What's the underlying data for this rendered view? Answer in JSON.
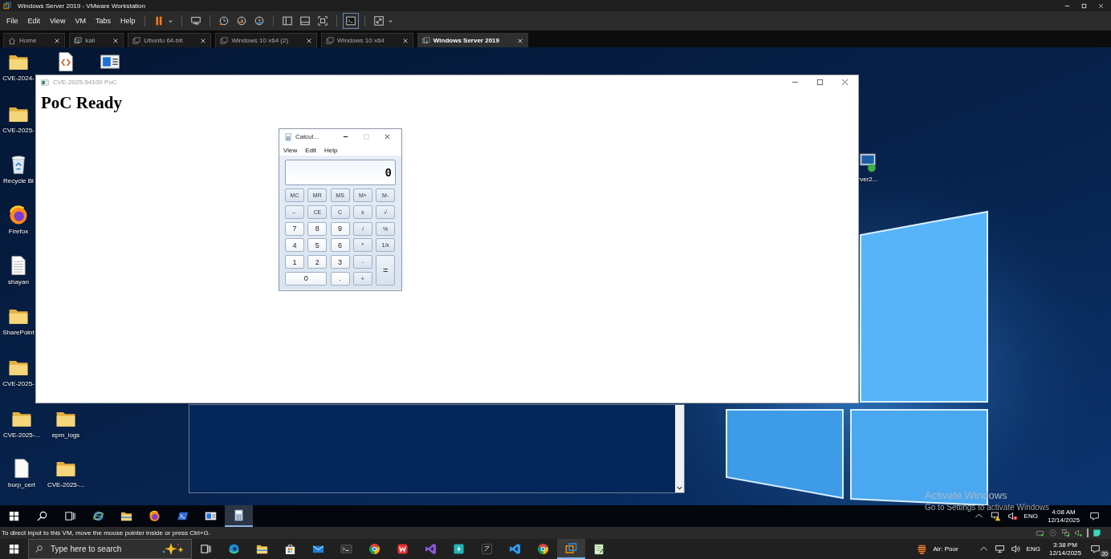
{
  "vmware": {
    "title": "Windows Server 2019 - VMware Workstation",
    "menu": [
      "File",
      "Edit",
      "View",
      "VM",
      "Tabs",
      "Help"
    ],
    "tabs": [
      {
        "label": "Home",
        "kind": "home",
        "selected": false
      },
      {
        "label": "kali",
        "kind": "running",
        "selected": false
      },
      {
        "label": "Ubuntu 64-bit",
        "kind": "vm",
        "selected": false
      },
      {
        "label": "Windows 10 x64 (2)",
        "kind": "vm",
        "selected": false
      },
      {
        "label": "Windows 10 x64",
        "kind": "vm",
        "selected": false
      },
      {
        "label": "Windows Server 2019",
        "kind": "running",
        "selected": true
      }
    ]
  },
  "desktop": {
    "icons": [
      {
        "kind": "folder",
        "label": "CVE-2024-"
      },
      {
        "kind": "code-file"
      },
      {
        "kind": "window-app"
      },
      {
        "kind": "folder",
        "label": "CVE-2025-"
      },
      {
        "kind": "recycle-bin",
        "label": "Recycle Bi"
      },
      {
        "kind": "firefox",
        "label": "Firefox"
      },
      {
        "kind": "text-file",
        "label": "shayan"
      },
      {
        "kind": "folder",
        "label": "SharePoint"
      },
      {
        "kind": "folder",
        "label": "CVE-2025-"
      },
      {
        "kind": "folder",
        "label": "CVE-2025-..."
      },
      {
        "kind": "folder",
        "label": "epm_logs"
      },
      {
        "kind": "blank-file",
        "label": "burp_cert"
      },
      {
        "kind": "folder",
        "label": "CVE-2025-..."
      },
      {
        "kind": "server",
        "label": "rver2..."
      }
    ]
  },
  "poc_window": {
    "title": "CVE-2025-54100 PoC",
    "heading": "PoC Ready"
  },
  "calculator": {
    "title": "Calcul...",
    "menu": [
      "View",
      "Edit",
      "Help"
    ],
    "display": "0",
    "keys": [
      {
        "label": "MC",
        "kind": "function"
      },
      {
        "label": "MR",
        "kind": "function"
      },
      {
        "label": "MS",
        "kind": "function"
      },
      {
        "label": "M+",
        "kind": "function"
      },
      {
        "label": "M-",
        "kind": "function"
      },
      {
        "label": "←",
        "kind": "function"
      },
      {
        "label": "CE",
        "kind": "function"
      },
      {
        "label": "C",
        "kind": "function"
      },
      {
        "label": "±",
        "kind": "function"
      },
      {
        "label": "√",
        "kind": "function"
      },
      {
        "label": "7",
        "kind": "digit"
      },
      {
        "label": "8",
        "kind": "digit"
      },
      {
        "label": "9",
        "kind": "digit"
      },
      {
        "label": "/",
        "kind": "function"
      },
      {
        "label": "%",
        "kind": "function"
      },
      {
        "label": "4",
        "kind": "digit"
      },
      {
        "label": "5",
        "kind": "digit"
      },
      {
        "label": "6",
        "kind": "digit"
      },
      {
        "label": "*",
        "kind": "function"
      },
      {
        "label": "1/x",
        "kind": "function"
      },
      {
        "label": "1",
        "kind": "digit"
      },
      {
        "label": "2",
        "kind": "digit"
      },
      {
        "label": "3",
        "kind": "digit"
      },
      {
        "label": "-",
        "kind": "function"
      },
      {
        "label": "=",
        "kind": "tall"
      },
      {
        "label": "0",
        "kind": "wide"
      },
      {
        "label": ".",
        "kind": "digit"
      },
      {
        "label": "+",
        "kind": "function"
      }
    ]
  },
  "activation": {
    "title": "Activate Windows",
    "text": "Go to Settings to activate Windows"
  },
  "guest_taskbar": {
    "apps": [
      {
        "kind": "search",
        "selected": false
      },
      {
        "kind": "taskview",
        "selected": false
      },
      {
        "kind": "ie",
        "selected": false
      },
      {
        "kind": "explorer",
        "selected": false
      },
      {
        "kind": "firefox",
        "selected": false
      },
      {
        "kind": "powershell",
        "selected": false
      },
      {
        "kind": "window-app",
        "selected": false
      },
      {
        "kind": "calculator",
        "selected": true
      }
    ],
    "language": "ENG",
    "time": "4:08 AM",
    "date": "12/14/2025"
  },
  "status_bar": {
    "text": "To direct input to this VM, move the mouse pointer inside or press Ctrl+G."
  },
  "host_taskbar": {
    "search_placeholder": "Type here to search",
    "apps": [
      {
        "kind": "taskview",
        "selected": false
      },
      {
        "kind": "edge",
        "selected": false
      },
      {
        "kind": "explorer",
        "selected": false
      },
      {
        "kind": "store",
        "selected": false
      },
      {
        "kind": "outlook",
        "selected": false
      },
      {
        "kind": "terminal",
        "selected": false
      },
      {
        "kind": "chrome",
        "selected": false
      },
      {
        "kind": "wps",
        "selected": false
      },
      {
        "kind": "visualstudio",
        "selected": false
      },
      {
        "kind": "bolt",
        "selected": false
      },
      {
        "kind": "dark-app",
        "selected": false
      },
      {
        "kind": "vscode",
        "selected": false
      },
      {
        "kind": "chrome",
        "selected": false
      },
      {
        "kind": "vmware",
        "selected": true
      },
      {
        "kind": "notepad",
        "selected": false
      }
    ],
    "weather": "Air: Poor",
    "language": "ENG",
    "time": "3:38 PM",
    "date": "12/14/2025",
    "notification_count": "20"
  }
}
